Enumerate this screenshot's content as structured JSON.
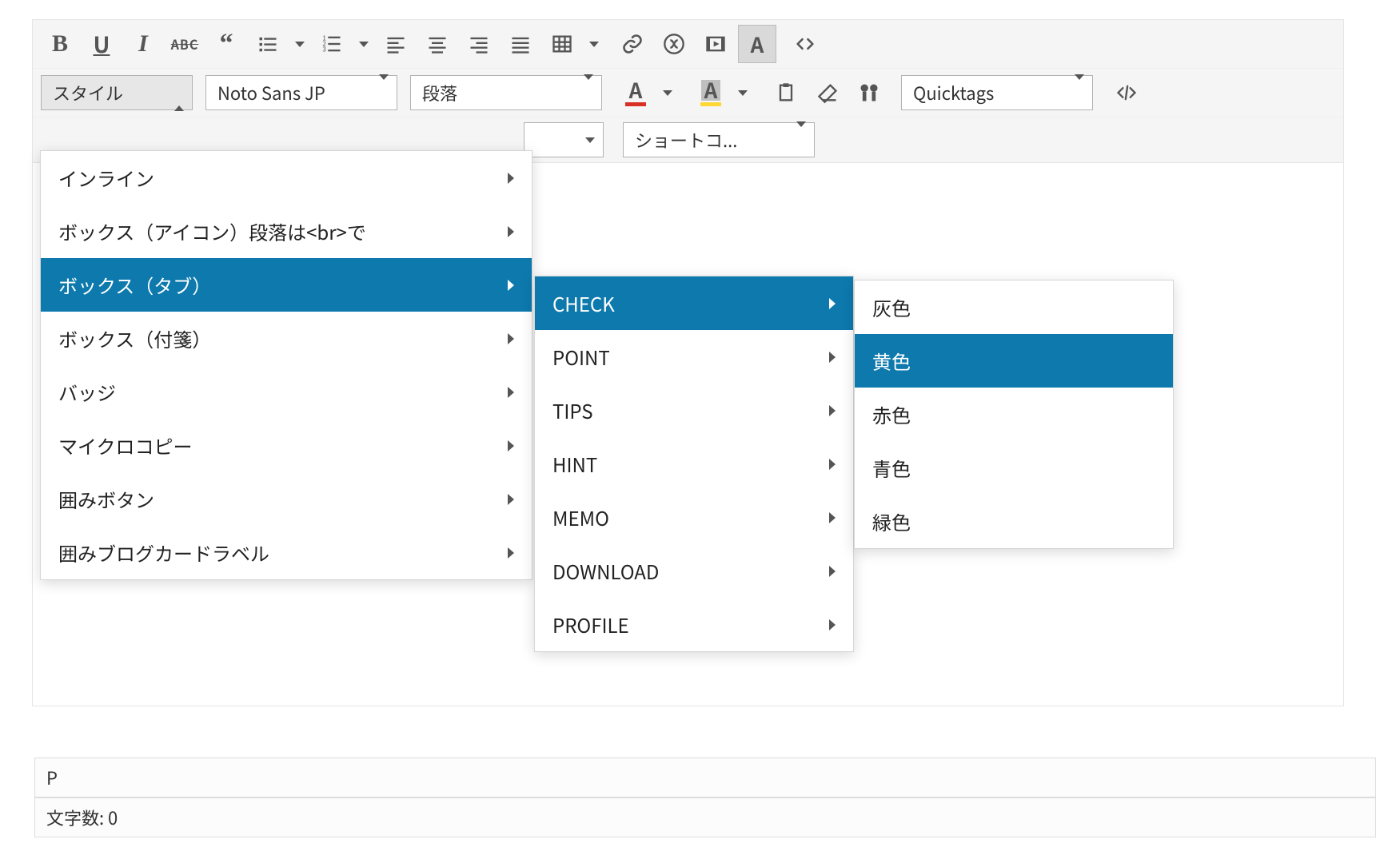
{
  "toolbar": {
    "selectors": {
      "style_label": "スタイル",
      "font_label": "Noto Sans JP",
      "block_label": "段落",
      "quicktags_label": "Quicktags",
      "shortcode_label": "ショートコ..."
    },
    "text_color_underline": "#d93025",
    "bg_color_underline": "#fdd835"
  },
  "styles_menu": {
    "items": [
      {
        "label": "インライン"
      },
      {
        "label": "ボックス（アイコン）段落は<br>で"
      },
      {
        "label": "ボックス（タブ）"
      },
      {
        "label": "ボックス（付箋）"
      },
      {
        "label": "バッジ"
      },
      {
        "label": "マイクロコピー"
      },
      {
        "label": "囲みボタン"
      },
      {
        "label": "囲みブログカードラベル"
      }
    ],
    "highlighted_index": 2
  },
  "sub_menu_1": {
    "items": [
      {
        "label": "CHECK"
      },
      {
        "label": "POINT"
      },
      {
        "label": "TIPS"
      },
      {
        "label": "HINT"
      },
      {
        "label": "MEMO"
      },
      {
        "label": "DOWNLOAD"
      },
      {
        "label": "PROFILE"
      }
    ],
    "highlighted_index": 0
  },
  "sub_menu_2": {
    "items": [
      {
        "label": "灰色"
      },
      {
        "label": "黄色"
      },
      {
        "label": "赤色"
      },
      {
        "label": "青色"
      },
      {
        "label": "緑色"
      }
    ],
    "highlighted_index": 1
  },
  "status": {
    "path": "P",
    "word_count_label": "文字数: 0"
  }
}
